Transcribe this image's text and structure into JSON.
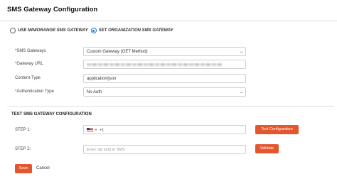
{
  "header": {
    "title": "SMS Gateway Configuration"
  },
  "gateway_choice": {
    "options": [
      {
        "label": "USE MINIORANGE SMS GATEWAY",
        "selected": false
      },
      {
        "label": "SET ORGANIZATION SMS GATEWAY",
        "selected": true
      }
    ]
  },
  "form": {
    "sms_gateways": {
      "label": "*SMS Gateways",
      "value": "Custom Gateway (GET Method)"
    },
    "gateway_url": {
      "label": "*Gateway URL",
      "value": ""
    },
    "content_type": {
      "label": "Content-Type",
      "value": "application/json"
    },
    "auth_type": {
      "label": "*Authentication Type",
      "value": "No Auth"
    }
  },
  "test_section": {
    "title": "TEST SMS GATEWAY CONFIGURATION",
    "step1": {
      "label": "STEP 1:",
      "country_code": "+1",
      "button": "Test Configuration"
    },
    "step2": {
      "label": "STEP 2:",
      "placeholder": "Enter otp sent in SMS",
      "button": "Validate"
    }
  },
  "footer": {
    "save": "Save",
    "cancel": "Cancel"
  },
  "colors": {
    "accent": "#e4572e",
    "radio": "#1d6fe0"
  }
}
